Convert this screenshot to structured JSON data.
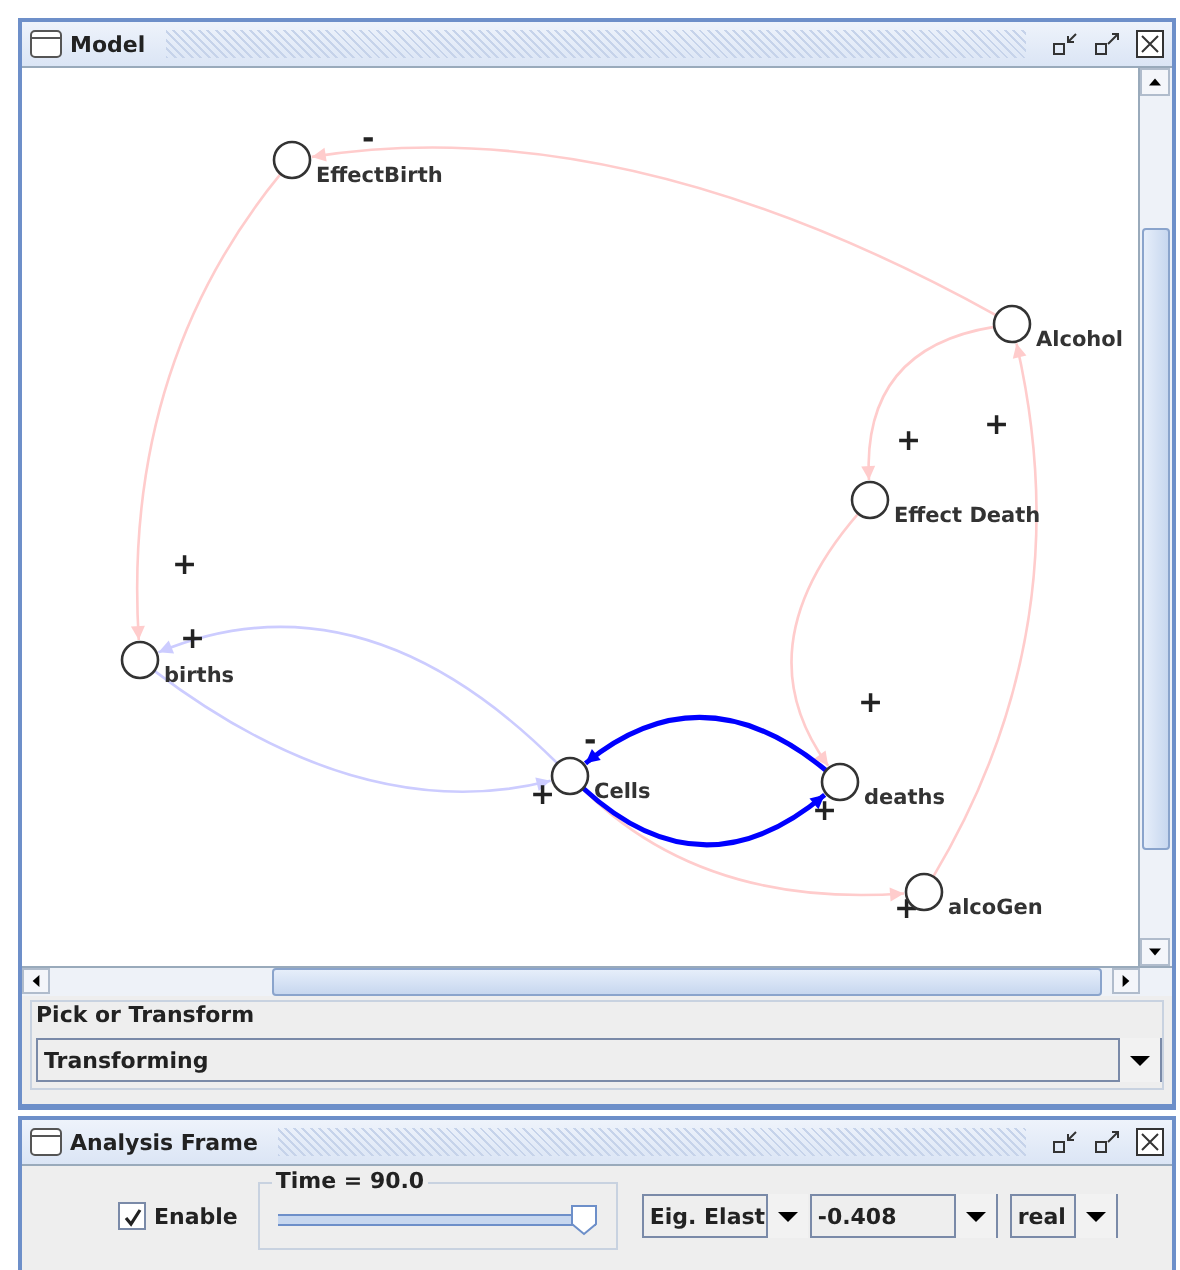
{
  "model_frame": {
    "title": "Model",
    "diagram": {
      "nodes": [
        {
          "label": "EffectBirth"
        },
        {
          "label": "Alcohol"
        },
        {
          "label": "Effect Death"
        },
        {
          "label": "births"
        },
        {
          "label": "Cells"
        },
        {
          "label": "deaths"
        },
        {
          "label": "alcoGen"
        }
      ],
      "edges": [
        {
          "sign": "-",
          "color": "#ffcccc",
          "highlighted": false
        },
        {
          "sign": "+",
          "color": "#ffcccc",
          "highlighted": false
        },
        {
          "sign": "+",
          "color": "#ffcccc",
          "highlighted": false
        },
        {
          "sign": "+",
          "color": "#ffcccc",
          "highlighted": false
        },
        {
          "sign": "+",
          "color": "#ffcccc",
          "highlighted": false
        },
        {
          "sign": "+",
          "color": "#ffcccc",
          "highlighted": false
        },
        {
          "sign": "+",
          "color": "#ccccff",
          "highlighted": false
        },
        {
          "sign": "+",
          "color": "#ccccff",
          "highlighted": false
        },
        {
          "sign": "-",
          "color": "#0000ff",
          "highlighted": true
        },
        {
          "sign": "+",
          "color": "#0000ff",
          "highlighted": true
        }
      ]
    },
    "mode_group": {
      "title": "Pick or Transform",
      "value": "Transforming"
    }
  },
  "analysis_frame": {
    "title": "Analysis Frame",
    "enable": {
      "label": "Enable",
      "checked": true
    },
    "time_slider": {
      "label": "Time = 90.0",
      "level": 0.96
    },
    "dropdowns": [
      {
        "value": "Eig. Elast"
      },
      {
        "value": "-0.408"
      },
      {
        "value": "real"
      }
    ]
  }
}
